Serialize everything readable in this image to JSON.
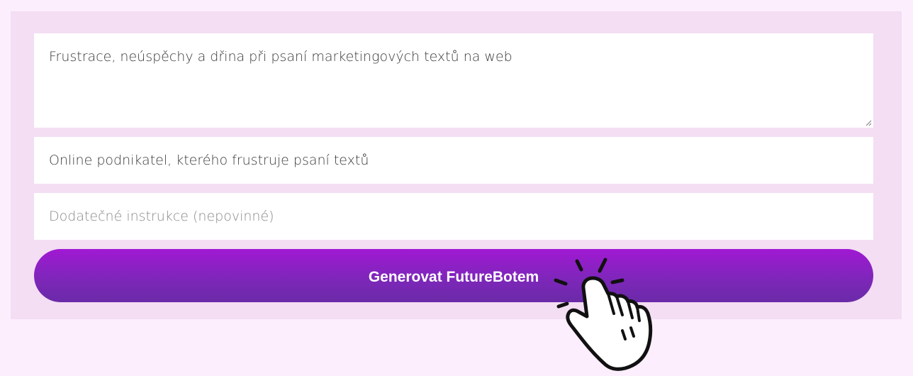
{
  "form": {
    "topic": {
      "value": "Frustrace, neúspěchy a dřina při psaní marketingových textů na web"
    },
    "audience": {
      "value": "Online podnikatel, kterého frustruje psaní textů"
    },
    "instructions": {
      "value": "",
      "placeholder": "Dodatečné instrukce (nepovinné)"
    },
    "submit_label": "Generovat FutureBotem"
  },
  "icons": {
    "resize": "resize-grip-icon",
    "pointer": "pointing-hand-click-icon"
  },
  "colors": {
    "page_background": "#fdeefd",
    "panel_background": "#f3def3",
    "button_gradient_top": "#a019d3",
    "button_gradient_bottom": "#6a2aa8",
    "button_text": "#ffffff"
  }
}
